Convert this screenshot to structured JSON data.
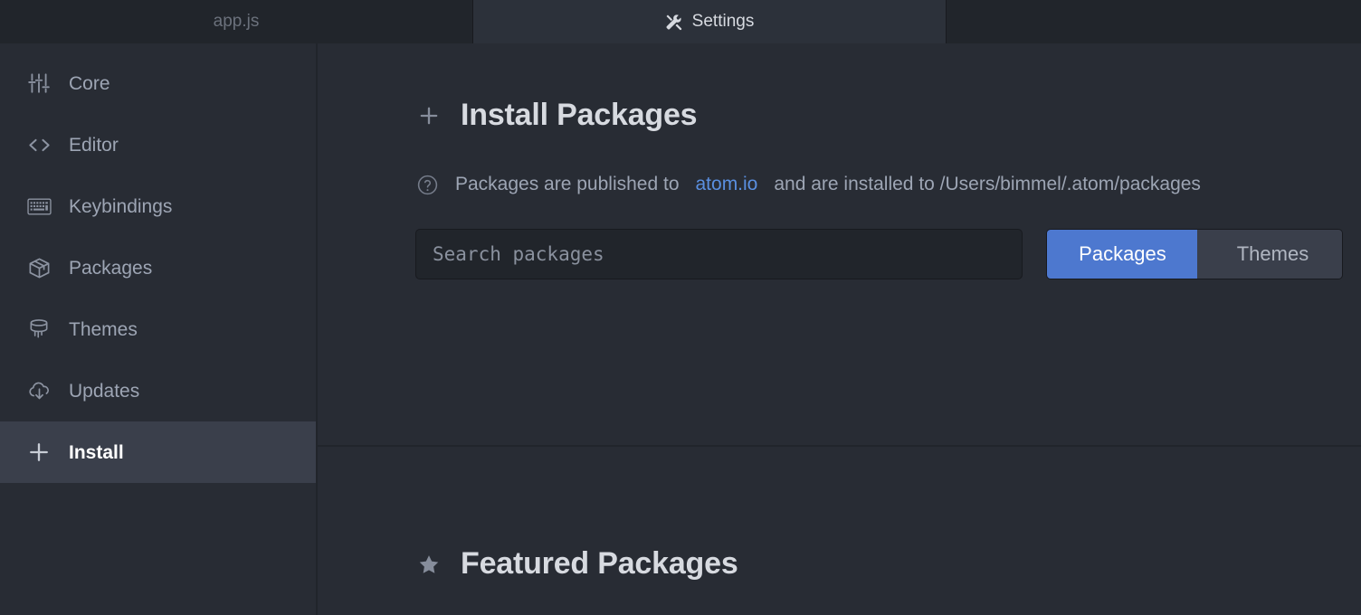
{
  "tabs": [
    {
      "label": "app.js",
      "icon": "",
      "active": false
    },
    {
      "label": "Settings",
      "icon": "tools-icon",
      "active": true
    },
    {
      "label": "",
      "icon": "",
      "active": false
    }
  ],
  "sidebar": {
    "items": [
      {
        "label": "Core",
        "icon": "sliders-icon",
        "selected": false
      },
      {
        "label": "Editor",
        "icon": "code-icon",
        "selected": false
      },
      {
        "label": "Keybindings",
        "icon": "keyboard-icon",
        "selected": false
      },
      {
        "label": "Packages",
        "icon": "package-icon",
        "selected": false
      },
      {
        "label": "Themes",
        "icon": "paintcan-icon",
        "selected": false
      },
      {
        "label": "Updates",
        "icon": "cloud-download-icon",
        "selected": false
      },
      {
        "label": "Install",
        "icon": "plus-icon",
        "selected": true
      }
    ]
  },
  "install_panel": {
    "heading": "Install Packages",
    "heading_icon": "plus-icon",
    "description_icon": "question-circle-icon",
    "description_prefix": "Packages are published to ",
    "description_link": "atom.io",
    "description_suffix": " and are installed to /Users/bimmel/.atom/packages",
    "search_placeholder": "Search packages",
    "search_value": "",
    "filters": [
      {
        "label": "Packages",
        "active": true
      },
      {
        "label": "Themes",
        "active": false
      }
    ]
  },
  "featured_panel": {
    "heading": "Featured Packages",
    "heading_icon": "star-icon"
  },
  "colors": {
    "background": "#282c34",
    "tabbar": "#21252b",
    "tab_active": "#2c313a",
    "divider": "#21252b",
    "selected_row": "#3a3f4b",
    "accent_blue": "#4d78cf",
    "link_blue": "#5a8fe0",
    "text_primary": "#d7dae0",
    "text_secondary": "#9da5b4"
  }
}
